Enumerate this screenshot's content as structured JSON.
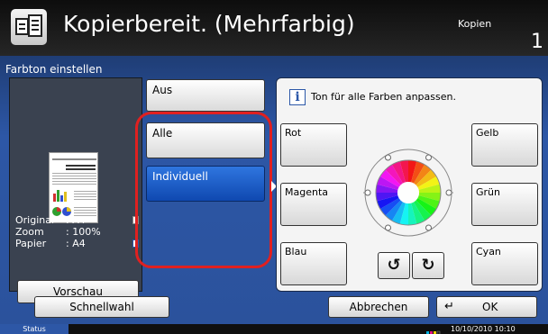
{
  "header": {
    "title": "Kopierbereit. (Mehrfarbig)",
    "mode": "Kopien",
    "count": "1"
  },
  "panel": {
    "title": "Farbton einstellen"
  },
  "preview": {
    "original_label": "Original",
    "original_value": ": A4",
    "zoom_label": "Zoom",
    "zoom_value": ": 100%",
    "paper_label": "Papier",
    "paper_value": ": A4",
    "button_label": "Vorschau"
  },
  "options": [
    {
      "label": "Aus",
      "selected": false
    },
    {
      "label": "Alle",
      "selected": false
    },
    {
      "label": "Individuell",
      "selected": true
    }
  ],
  "color_panel": {
    "hint": "Ton für alle Farben anpassen.",
    "info_glyph": "i",
    "buttons": {
      "red": "Rot",
      "yellow": "Gelb",
      "magenta": "Magenta",
      "green": "Grün",
      "blue": "Blau",
      "cyan": "Cyan"
    },
    "rotate_ccw_glyph": "↺",
    "rotate_cw_glyph": "↻"
  },
  "bottom": {
    "quick_label": "Schnellwahl",
    "cancel_label": "Abbrechen",
    "ok_label": "OK",
    "ok_icon_glyph": "↵"
  },
  "status": {
    "label": "Status",
    "datetime": "10/10/2010  10:10"
  },
  "colors": {
    "accent": "#2d57a6",
    "selected": "#1a5cc8",
    "highlight": "#e02020"
  }
}
